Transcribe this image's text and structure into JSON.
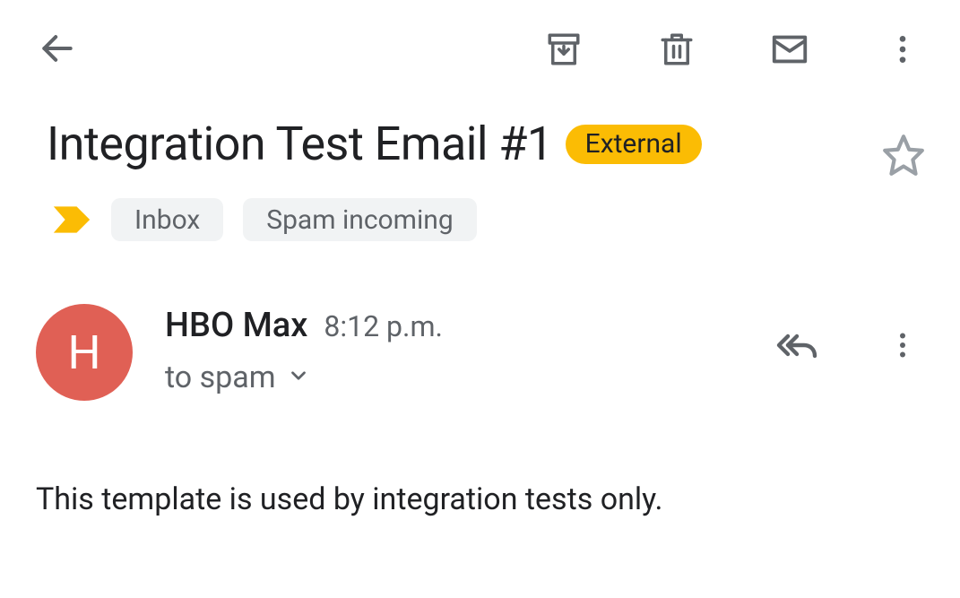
{
  "subject": "Integration Test Email #1",
  "badge": {
    "external": "External"
  },
  "labels": [
    "Inbox",
    "Spam incoming"
  ],
  "sender": {
    "name": "HBO Max",
    "initial": "H",
    "time": "8:12 p.m.",
    "recipient_line": "to spam"
  },
  "body": "This template is used by integration tests only."
}
